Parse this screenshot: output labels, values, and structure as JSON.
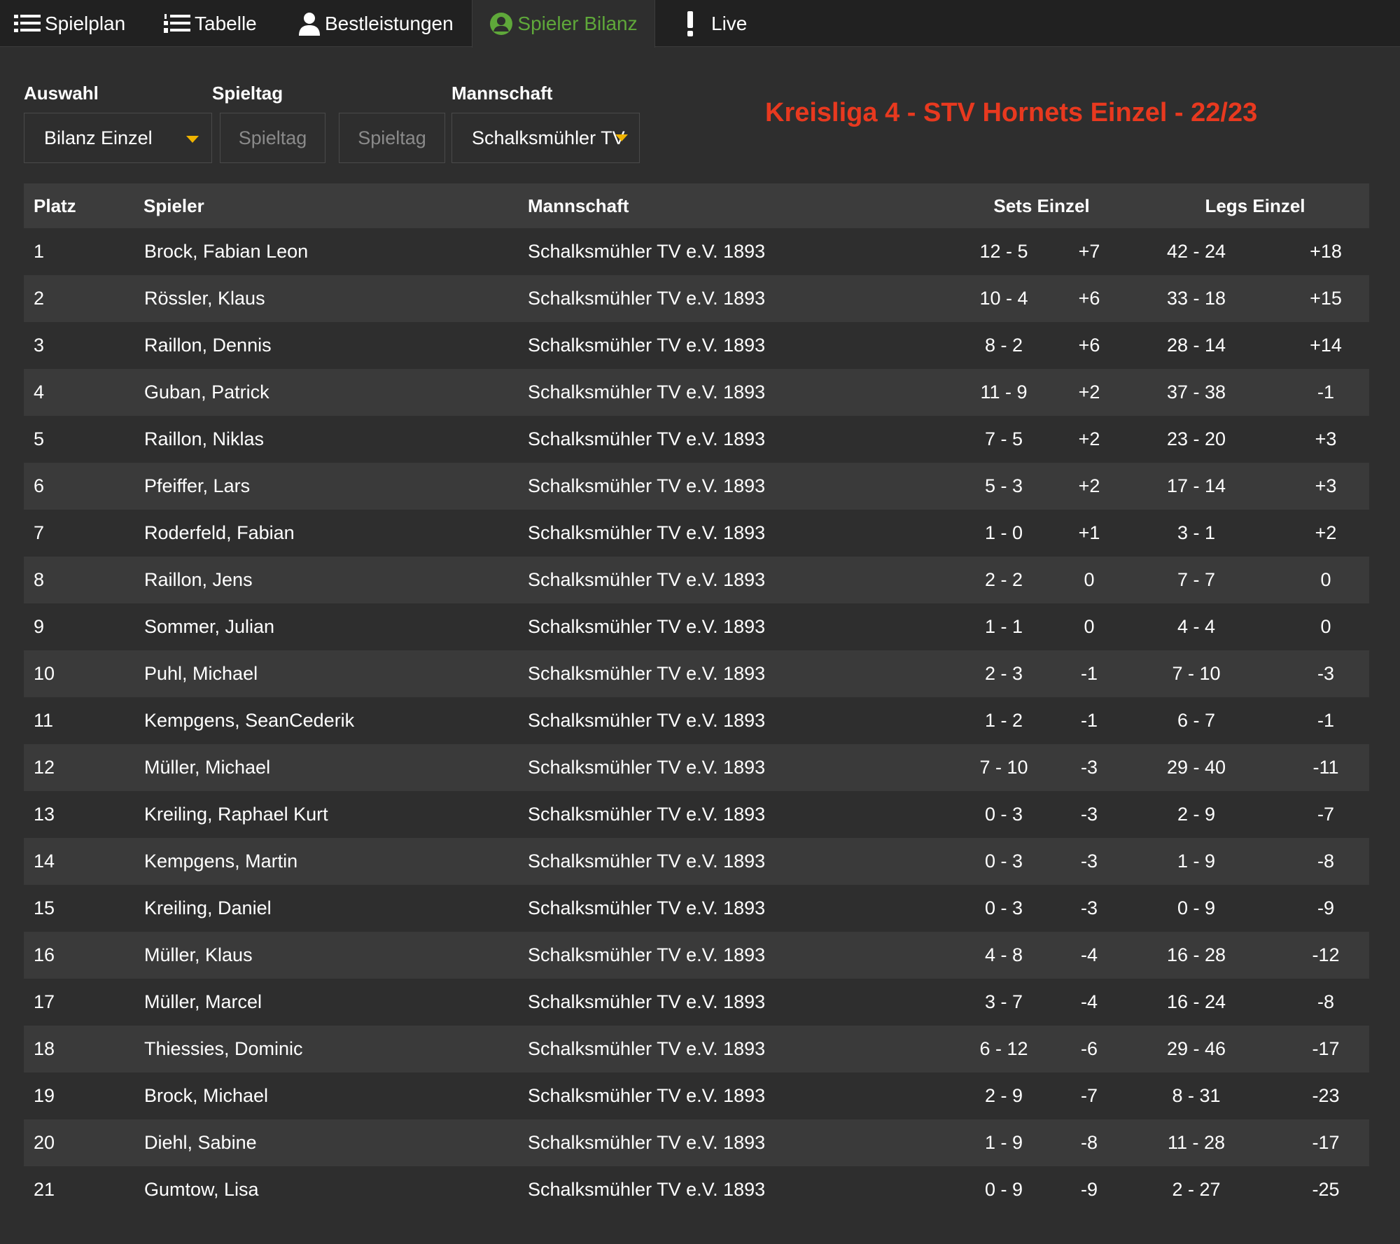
{
  "nav": {
    "items": [
      {
        "label": "Spielplan",
        "icon": "list-icon"
      },
      {
        "label": "Tabelle",
        "icon": "numbered-list-icon"
      },
      {
        "label": "Bestleistungen",
        "icon": "user-icon"
      },
      {
        "label": "Spieler Bilanz",
        "icon": "user-circle-icon",
        "active": true
      },
      {
        "label": "Live",
        "icon": "exclamation-icon"
      }
    ],
    "active_color": "#5fa83a"
  },
  "filters": {
    "auswahl_label": "Auswahl",
    "spieltag_label": "Spieltag",
    "mannschaft_label": "Mannschaft",
    "auswahl_value": "Bilanz Einzel",
    "spieltag_from_placeholder": "Spieltag",
    "spieltag_to_placeholder": "Spieltag",
    "mannschaft_value": "Schalksmühler TV"
  },
  "league_title": "Kreisliga 4 - STV Hornets Einzel - 22/23",
  "colors": {
    "title": "#e8391f",
    "caret": "#f0b400"
  },
  "table": {
    "headers": {
      "platz": "Platz",
      "spieler": "Spieler",
      "mannschaft": "Mannschaft",
      "sets": "Sets Einzel",
      "legs": "Legs Einzel"
    },
    "rows": [
      {
        "platz": "1",
        "spieler": "Brock, Fabian Leon",
        "team": "Schalksmühler TV e.V. 1893",
        "sets": "12 - 5",
        "sets_diff": "+7",
        "legs": "42 - 24",
        "legs_diff": "+18"
      },
      {
        "platz": "2",
        "spieler": "Rössler, Klaus",
        "team": "Schalksmühler TV e.V. 1893",
        "sets": "10 - 4",
        "sets_diff": "+6",
        "legs": "33 - 18",
        "legs_diff": "+15"
      },
      {
        "platz": "3",
        "spieler": "Raillon, Dennis",
        "team": "Schalksmühler TV e.V. 1893",
        "sets": "8 - 2",
        "sets_diff": "+6",
        "legs": "28 - 14",
        "legs_diff": "+14"
      },
      {
        "platz": "4",
        "spieler": "Guban, Patrick",
        "team": "Schalksmühler TV e.V. 1893",
        "sets": "11 - 9",
        "sets_diff": "+2",
        "legs": "37 - 38",
        "legs_diff": "-1"
      },
      {
        "platz": "5",
        "spieler": "Raillon, Niklas",
        "team": "Schalksmühler TV e.V. 1893",
        "sets": "7 - 5",
        "sets_diff": "+2",
        "legs": "23 - 20",
        "legs_diff": "+3"
      },
      {
        "platz": "6",
        "spieler": "Pfeiffer, Lars",
        "team": "Schalksmühler TV e.V. 1893",
        "sets": "5 - 3",
        "sets_diff": "+2",
        "legs": "17 - 14",
        "legs_diff": "+3"
      },
      {
        "platz": "7",
        "spieler": "Roderfeld, Fabian",
        "team": "Schalksmühler TV e.V. 1893",
        "sets": "1 - 0",
        "sets_diff": "+1",
        "legs": "3 - 1",
        "legs_diff": "+2"
      },
      {
        "platz": "8",
        "spieler": "Raillon, Jens",
        "team": "Schalksmühler TV e.V. 1893",
        "sets": "2 - 2",
        "sets_diff": "0",
        "legs": "7 - 7",
        "legs_diff": "0"
      },
      {
        "platz": "9",
        "spieler": "Sommer, Julian",
        "team": "Schalksmühler TV e.V. 1893",
        "sets": "1 - 1",
        "sets_diff": "0",
        "legs": "4 - 4",
        "legs_diff": "0"
      },
      {
        "platz": "10",
        "spieler": "Puhl, Michael",
        "team": "Schalksmühler TV e.V. 1893",
        "sets": "2 - 3",
        "sets_diff": "-1",
        "legs": "7 - 10",
        "legs_diff": "-3"
      },
      {
        "platz": "11",
        "spieler": "Kempgens, SeanCederik",
        "team": "Schalksmühler TV e.V. 1893",
        "sets": "1 - 2",
        "sets_diff": "-1",
        "legs": "6 - 7",
        "legs_diff": "-1"
      },
      {
        "platz": "12",
        "spieler": "Müller, Michael",
        "team": "Schalksmühler TV e.V. 1893",
        "sets": "7 - 10",
        "sets_diff": "-3",
        "legs": "29 - 40",
        "legs_diff": "-11"
      },
      {
        "platz": "13",
        "spieler": "Kreiling, Raphael Kurt",
        "team": "Schalksmühler TV e.V. 1893",
        "sets": "0 - 3",
        "sets_diff": "-3",
        "legs": "2 - 9",
        "legs_diff": "-7"
      },
      {
        "platz": "14",
        "spieler": "Kempgens, Martin",
        "team": "Schalksmühler TV e.V. 1893",
        "sets": "0 - 3",
        "sets_diff": "-3",
        "legs": "1 - 9",
        "legs_diff": "-8"
      },
      {
        "platz": "15",
        "spieler": "Kreiling, Daniel",
        "team": "Schalksmühler TV e.V. 1893",
        "sets": "0 - 3",
        "sets_diff": "-3",
        "legs": "0 - 9",
        "legs_diff": "-9"
      },
      {
        "platz": "16",
        "spieler": "Müller, Klaus",
        "team": "Schalksmühler TV e.V. 1893",
        "sets": "4 - 8",
        "sets_diff": "-4",
        "legs": "16 - 28",
        "legs_diff": "-12"
      },
      {
        "platz": "17",
        "spieler": "Müller, Marcel",
        "team": "Schalksmühler TV e.V. 1893",
        "sets": "3 - 7",
        "sets_diff": "-4",
        "legs": "16 - 24",
        "legs_diff": "-8"
      },
      {
        "platz": "18",
        "spieler": "Thiessies, Dominic",
        "team": "Schalksmühler TV e.V. 1893",
        "sets": "6 - 12",
        "sets_diff": "-6",
        "legs": "29 - 46",
        "legs_diff": "-17"
      },
      {
        "platz": "19",
        "spieler": "Brock, Michael",
        "team": "Schalksmühler TV e.V. 1893",
        "sets": "2 - 9",
        "sets_diff": "-7",
        "legs": "8 - 31",
        "legs_diff": "-23"
      },
      {
        "platz": "20",
        "spieler": "Diehl, Sabine",
        "team": "Schalksmühler TV e.V. 1893",
        "sets": "1 - 9",
        "sets_diff": "-8",
        "legs": "11 - 28",
        "legs_diff": "-17"
      },
      {
        "platz": "21",
        "spieler": "Gumtow, Lisa",
        "team": "Schalksmühler TV e.V. 1893",
        "sets": "0 - 9",
        "sets_diff": "-9",
        "legs": "2 - 27",
        "legs_diff": "-25"
      }
    ]
  }
}
